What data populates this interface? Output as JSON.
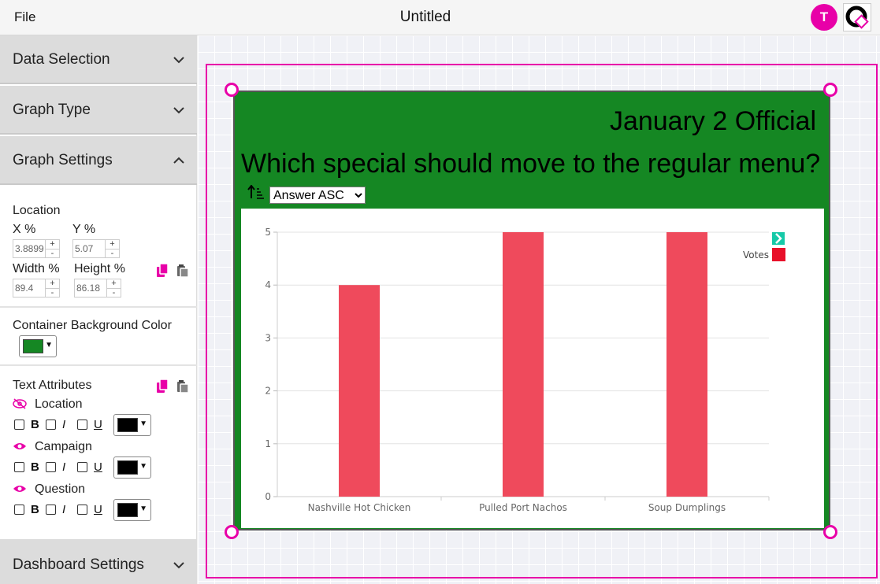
{
  "topbar": {
    "file_label": "File",
    "doc_title": "Untitled",
    "avatar_initial": "T",
    "accent": "#e800a8"
  },
  "sidebar": {
    "sections": {
      "data_selection": "Data Selection",
      "graph_type": "Graph Type",
      "graph_settings": "Graph Settings",
      "dashboard_settings": "Dashboard Settings"
    },
    "location": {
      "title": "Location",
      "x_label": "X %",
      "y_label": "Y %",
      "x_value": "3.8899",
      "y_value": "5.07",
      "width_label": "Width %",
      "height_label": "Height %",
      "width_value": "89.4",
      "height_value": "86.18"
    },
    "container_bg": {
      "label": "Container Background Color",
      "color": "#158723"
    },
    "text_attributes": {
      "title": "Text Attributes",
      "items": [
        {
          "name": "Location",
          "visible": false,
          "color": "#000000"
        },
        {
          "name": "Campaign",
          "visible": true,
          "color": "#000000"
        },
        {
          "name": "Question",
          "visible": true,
          "color": "#000000"
        }
      ],
      "bold_label": "B",
      "italic_label": "I",
      "underline_label": "U"
    }
  },
  "widget": {
    "campaign": "January 2 Official",
    "question": "Which special should move to the regular menu?",
    "sort_options": [
      "Answer ASC"
    ],
    "sort_selected": "Answer ASC"
  },
  "chart_data": {
    "type": "bar",
    "categories": [
      "Nashville Hot Chicken",
      "Pulled Port Nachos",
      "Soup Dumplings"
    ],
    "series": [
      {
        "name": "Votes",
        "values": [
          4,
          5,
          5
        ],
        "color": "#ef4a5c"
      }
    ],
    "legend_swatch_color": "#e8102a",
    "ylim": [
      0,
      5
    ],
    "yticks": [
      0,
      1,
      2,
      3,
      4,
      5
    ],
    "grid": true,
    "legend_position": "top-right"
  }
}
